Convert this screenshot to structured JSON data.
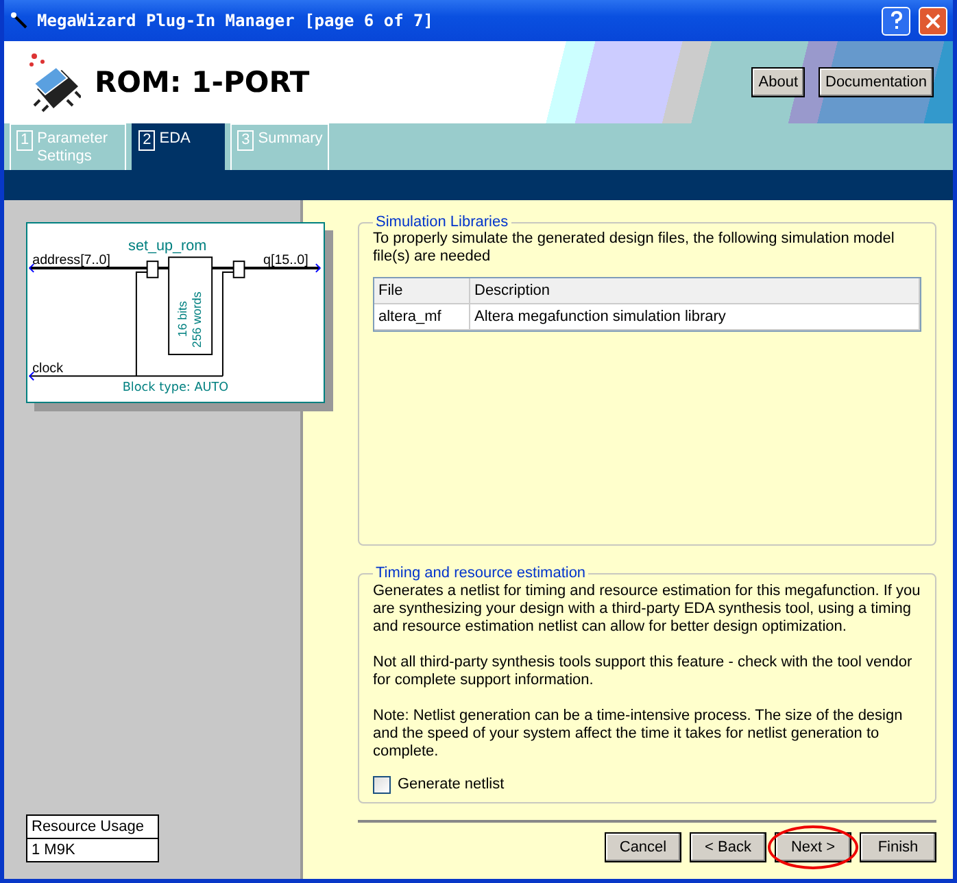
{
  "window": {
    "title": "MegaWizard Plug-In Manager [page 6 of 7]"
  },
  "header": {
    "title": "ROM: 1-PORT",
    "buttons": [
      "About",
      "Documentation"
    ]
  },
  "tabs": [
    {
      "number": "1",
      "label": "Parameter Settings",
      "selected": false
    },
    {
      "number": "2",
      "label": "EDA",
      "selected": true
    },
    {
      "number": "3",
      "label": "Summary",
      "selected": false
    }
  ],
  "diagram": {
    "name": "set_up_rom",
    "input": "address[7..0]",
    "output": "q[15..0]",
    "clock": "clock",
    "memory_lines": [
      "16 bits",
      "256 words"
    ],
    "block_type": "Block type: AUTO"
  },
  "resource_usage": {
    "heading": "Resource Usage",
    "value": "1 M9K"
  },
  "simulation_libraries": {
    "title": "Simulation Libraries",
    "description": "To properly simulate the generated design files, the following simulation model file(s) are needed",
    "columns": [
      "File",
      "Description"
    ],
    "rows": [
      [
        "altera_mf",
        "Altera megafunction simulation library"
      ]
    ]
  },
  "timing": {
    "title": "Timing and resource estimation",
    "paragraphs": [
      "Generates a netlist for timing and resource estimation for this megafunction. If you are synthesizing your design with a third-party EDA synthesis tool, using a timing and resource estimation netlist can allow for better design optimization.",
      "Not all third-party synthesis tools support this feature - check with the tool vendor for complete support information.",
      "Note: Netlist generation can be a time-intensive process. The size of the design and the speed of your system affect the time it takes for netlist generation to complete."
    ],
    "checkbox": {
      "label": "Generate netlist",
      "checked": false
    }
  },
  "buttons": [
    {
      "label": "Cancel",
      "highlighted": false
    },
    {
      "label": "< Back",
      "highlighted": false
    },
    {
      "label": "Next >",
      "highlighted": true
    },
    {
      "label": "Finish",
      "highlighted": false
    }
  ]
}
